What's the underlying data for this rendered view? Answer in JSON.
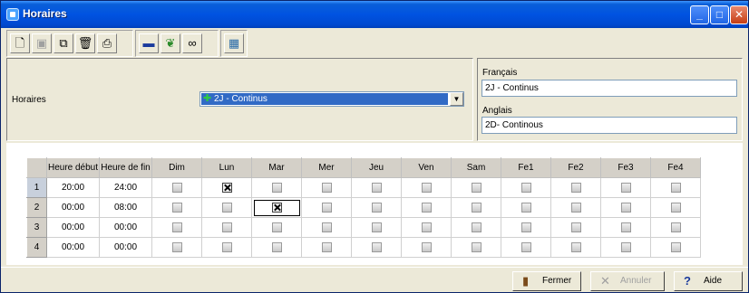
{
  "window": {
    "title": "Horaires"
  },
  "toolbar": {
    "buttons": [
      {
        "name": "new-icon",
        "glyph": "🗋"
      },
      {
        "name": "save-icon",
        "glyph": "💾"
      },
      {
        "name": "copy-icon",
        "glyph": "⧉"
      },
      {
        "name": "trash-icon",
        "glyph": "🗑"
      },
      {
        "name": "print-icon",
        "glyph": "⎙"
      },
      {
        "name": "line-icon",
        "glyph": "▬"
      },
      {
        "name": "leaf-icon",
        "glyph": "🍃"
      },
      {
        "name": "binoculars-icon",
        "glyph": "🔭"
      },
      {
        "name": "grid-report-icon",
        "glyph": "▦"
      }
    ]
  },
  "form": {
    "horaires_label": "Horaires",
    "horaires_selected": "2J - Continus",
    "francais_label": "Français",
    "francais_value": "2J - Continus",
    "anglais_label": "Anglais",
    "anglais_value": "2D- Continous"
  },
  "grid": {
    "columns": [
      "Heure début",
      "Heure de fin",
      "Dim",
      "Lun",
      "Mar",
      "Mer",
      "Jeu",
      "Ven",
      "Sam",
      "Fe1",
      "Fe2",
      "Fe3",
      "Fe4"
    ],
    "rows": [
      {
        "num": "1",
        "start": "20:00",
        "end": "24:00",
        "checks": [
          false,
          true,
          false,
          false,
          false,
          false,
          false,
          false,
          false,
          false,
          false
        ]
      },
      {
        "num": "2",
        "start": "00:00",
        "end": "08:00",
        "checks": [
          false,
          false,
          true,
          false,
          false,
          false,
          false,
          false,
          false,
          false,
          false
        ]
      },
      {
        "num": "3",
        "start": "00:00",
        "end": "00:00",
        "checks": [
          false,
          false,
          false,
          false,
          false,
          false,
          false,
          false,
          false,
          false,
          false
        ]
      },
      {
        "num": "4",
        "start": "00:00",
        "end": "00:00",
        "checks": [
          false,
          false,
          false,
          false,
          false,
          false,
          false,
          false,
          false,
          false,
          false
        ]
      }
    ]
  },
  "buttons": {
    "fermer": "Fermer",
    "annuler": "Annuler",
    "aide": "Aide"
  },
  "colors": {
    "titlebar": "#0053e1",
    "selection": "#316ac5"
  }
}
